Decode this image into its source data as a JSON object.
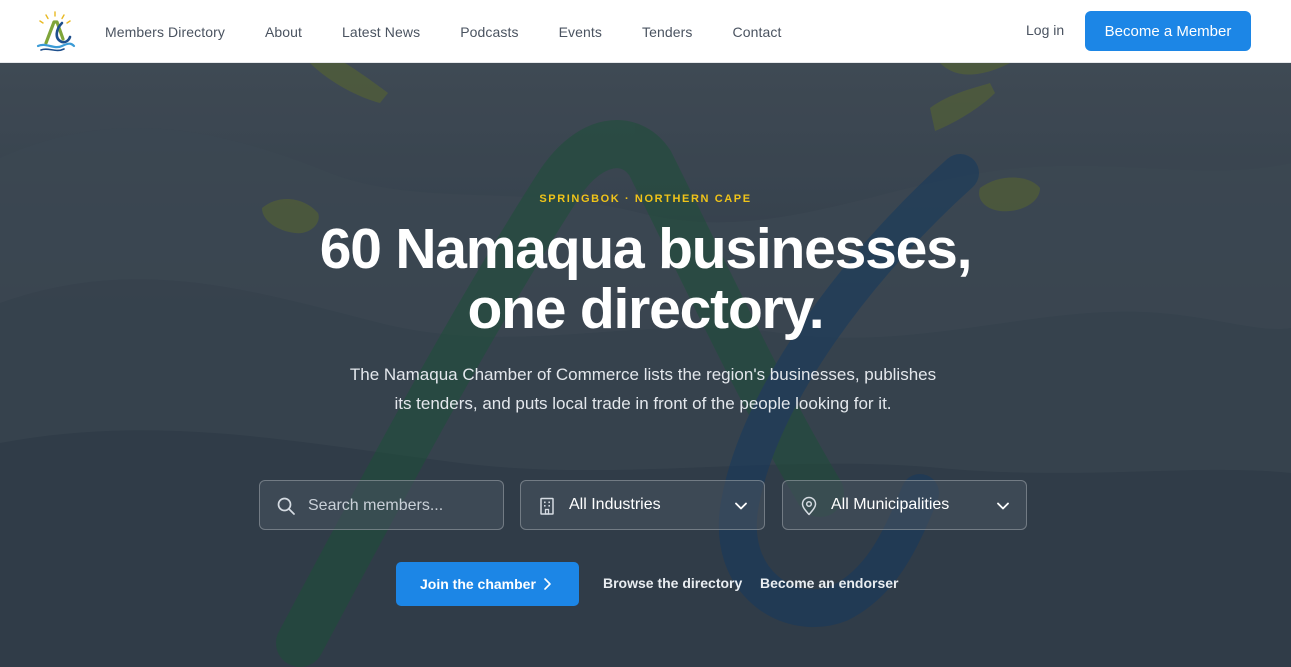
{
  "nav": {
    "items": [
      {
        "label": "Members Directory"
      },
      {
        "label": "About"
      },
      {
        "label": "Latest News"
      },
      {
        "label": "Podcasts"
      },
      {
        "label": "Events"
      },
      {
        "label": "Tenders"
      },
      {
        "label": "Contact"
      }
    ],
    "login_label": "Log in",
    "cta_label": "Become a Member"
  },
  "hero": {
    "eyebrow": "SPRINGBOK · NORTHERN CAPE",
    "headline_line1": "60 Namaqua businesses,",
    "headline_line2": "one directory.",
    "subtext": "The Namaqua Chamber of Commerce lists the region's businesses, publishes its tenders, and puts local trade in front of the people looking for it."
  },
  "filters": {
    "search_placeholder": "Search members...",
    "industry_value": "All Industries",
    "municipality_value": "All Municipalities"
  },
  "ctas": {
    "join_label": "Join the chamber",
    "browse_label": "Browse the directory",
    "endorser_label": "Become an endorser"
  },
  "colors": {
    "brand_blue": "#1c86e6",
    "eyebrow_yellow": "#f0c419",
    "logo_green": "#8fb03c",
    "logo_navy": "#1e4f8c"
  },
  "icons": {
    "logo": "namaqua-logo",
    "search": "search-icon",
    "industry": "building-icon",
    "municipality": "map-pin-icon",
    "dropdown": "chevron-down-icon",
    "join_arrow": "chevron-right-icon"
  }
}
